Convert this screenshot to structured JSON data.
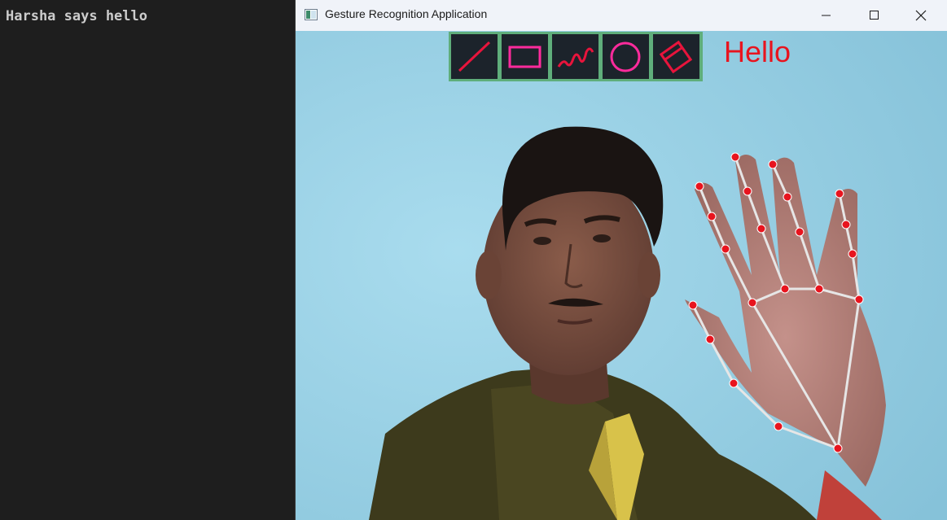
{
  "terminal": {
    "output": "Harsha says hello"
  },
  "window": {
    "title": "Gesture Recognition Application",
    "controls": [
      "minimize",
      "maximize",
      "close"
    ]
  },
  "toolbar": {
    "tools": [
      {
        "name": "line",
        "icon": "line-icon",
        "color": "#e8143c"
      },
      {
        "name": "rectangle",
        "icon": "rectangle-icon",
        "color": "#ff2b9c"
      },
      {
        "name": "freehand",
        "icon": "freehand-icon",
        "color": "#e8143c"
      },
      {
        "name": "circle",
        "icon": "circle-icon",
        "color": "#ff2b9c"
      },
      {
        "name": "eraser",
        "icon": "eraser-icon",
        "color": "#e8143c"
      }
    ]
  },
  "gesture": {
    "label": "Hello",
    "color": "#e8141e"
  },
  "colors": {
    "terminal_bg": "#1e1e1e",
    "toolbar_border": "#5fae7b",
    "landmark": "#e8141e",
    "skeleton": "#e6e6e6"
  }
}
